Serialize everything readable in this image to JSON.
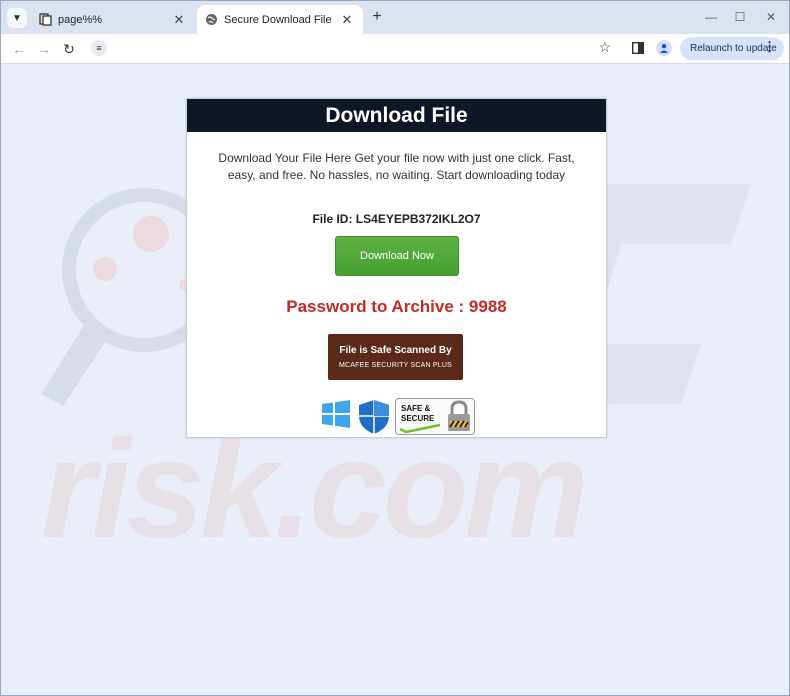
{
  "browser": {
    "tabs": [
      {
        "title": "page%%",
        "active": false
      },
      {
        "title": "Secure Download File",
        "active": true
      }
    ],
    "new_tab_symbol": "+",
    "relaunch_label": "Relaunch to update",
    "url": ""
  },
  "page": {
    "header_title": "Download File",
    "description": "Download Your File Here Get your file now with just one click. Fast, easy, and free. No hassles, no waiting. Start downloading today",
    "file_id": "File ID: LS4EYEPB372IKL2O7",
    "download_button": "Download Now",
    "password": "Password to Archive : 9988",
    "scan_line1": "File is Safe Scanned By",
    "scan_line2": "MCAFEE SECURITY SCAN PLUS",
    "safe_badge_line1": "SAFE &",
    "safe_badge_line2": "SECURE"
  },
  "watermark": {
    "text": "risk.com"
  },
  "colors": {
    "header_bg": "#0f1626",
    "download_button": "#4fa83a",
    "password_text": "#c42a28",
    "scan_badge_bg": "#5a2918",
    "page_bg": "#e9eef9"
  }
}
